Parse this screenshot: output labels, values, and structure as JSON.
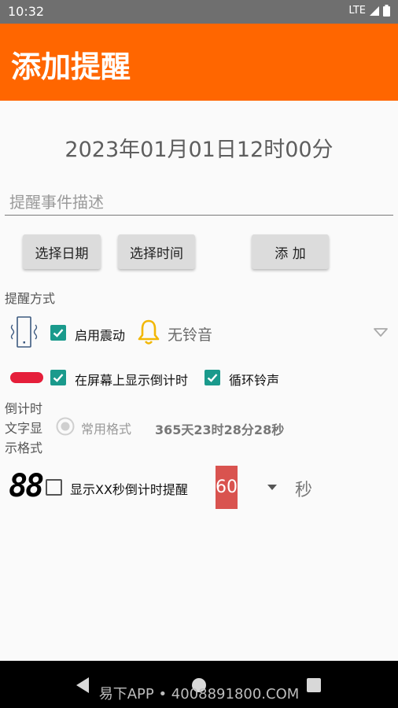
{
  "status_bar": {
    "time": "10:32",
    "network": "LTE"
  },
  "app_bar": {
    "title": "添加提醒"
  },
  "datetime_display": "2023年01月01日12时00分",
  "description_input": {
    "placeholder": "提醒事件描述",
    "value": ""
  },
  "buttons": {
    "select_date": "选择日期",
    "select_time": "选择时间",
    "add": "添 加"
  },
  "reminder_method": {
    "label": "提醒方式",
    "vibration_label": "启用震动",
    "vibration_checked": true,
    "ringtone_label": "无铃音",
    "countdown_on_screen_label": "在屏幕上显示倒计时",
    "countdown_on_screen_checked": true,
    "loop_ringtone_label": "循环铃声",
    "loop_ringtone_checked": true
  },
  "countdown_format": {
    "label_line1": "倒计时",
    "label_line2": "文字显",
    "label_line3": "示格式",
    "option_label": "常用格式",
    "sample": "365天23时28分28秒"
  },
  "countdown_reminder": {
    "digit_icon_text": "88",
    "label": "显示XX秒倒计时提醒",
    "checked": false,
    "seconds_value": "60",
    "unit": "秒"
  },
  "nav_bar": {
    "watermark": "易下APP • 4008891800.COM"
  },
  "colors": {
    "accent": "#ff6600",
    "checkbox": "#1a9a8c",
    "seconds_box": "#d9534f"
  }
}
